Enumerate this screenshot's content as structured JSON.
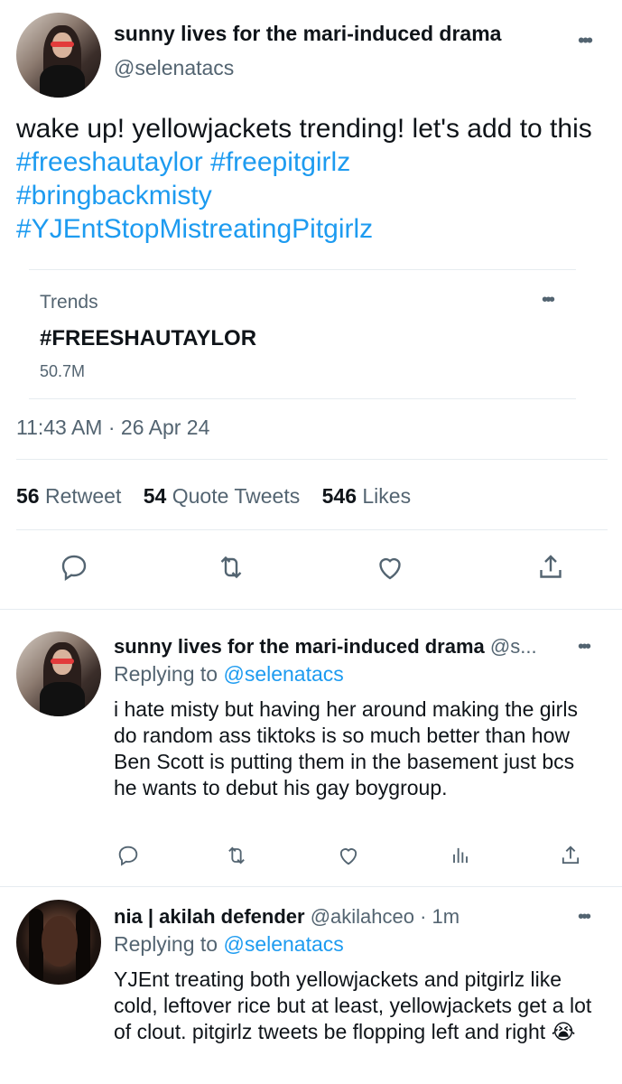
{
  "main_tweet": {
    "display_name": "sunny lives for the mari-induced drama",
    "handle": "@selenatacs",
    "text_plain": "wake up! yellowjackets trending! let's add to this ",
    "hashtags": [
      "#freeshautaylor",
      "#freepitgirlz",
      "#bringbackmisty",
      "#YJEntStopMistreatingPitgirlz"
    ],
    "more_icon": "more-dots-icon",
    "card": {
      "label": "Trends",
      "tag": "#FREESHAUTAYLOR",
      "count": "50.7M"
    },
    "timestamp": "11:43 AM · 26 Apr 24",
    "stats": {
      "retweets_num": "56",
      "retweets_label": "Retweet",
      "quotes_num": "54",
      "quotes_label": "Quote Tweets",
      "likes_num": "546",
      "likes_label": "Likes"
    }
  },
  "replies": [
    {
      "display_name": "sunny lives for the mari-induced drama",
      "handle_trunc": "@s...",
      "replying_label": "Replying to",
      "replying_handle": "@selenatacs",
      "text": "i hate misty but having her around making the girls do random ass tiktoks is so much better than how Ben Scott is putting them in the basement just bcs he wants to debut his gay boygroup."
    },
    {
      "display_name": "nia | akilah defender",
      "handle": "@akilahceo",
      "time": "· 1m",
      "replying_label": "Replying to",
      "replying_handle": "@selenatacs",
      "text": "YJEnt treating both yellowjackets and pitgirlz like cold, leftover rice but at least, yellowjackets get a lot of clout. pitgirlz tweets be flopping left and right",
      "emoji": "😭"
    }
  ],
  "colors": {
    "accent": "#1d9bf0",
    "text": "#0f1419",
    "secondary": "#536471",
    "divider": "#e6ecf0"
  }
}
